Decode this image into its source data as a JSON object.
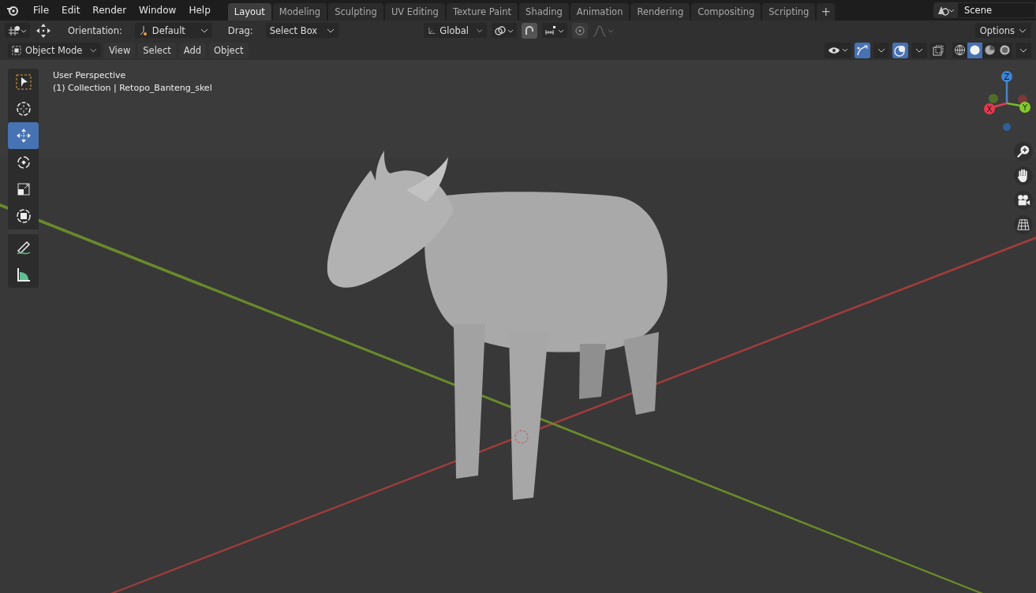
{
  "menu": [
    "File",
    "Edit",
    "Render",
    "Window",
    "Help"
  ],
  "workspaces": [
    {
      "label": "Layout",
      "selected": true
    },
    {
      "label": "Modeling",
      "selected": false
    },
    {
      "label": "Sculpting",
      "selected": false
    },
    {
      "label": "UV Editing",
      "selected": false
    },
    {
      "label": "Texture Paint",
      "selected": false
    },
    {
      "label": "Shading",
      "selected": false
    },
    {
      "label": "Animation",
      "selected": false
    },
    {
      "label": "Rendering",
      "selected": false
    },
    {
      "label": "Compositing",
      "selected": false
    },
    {
      "label": "Scripting",
      "selected": false
    }
  ],
  "add_tab": "+",
  "scene": "Scene",
  "tool_header": {
    "orientation_label": "Orientation:",
    "orientation": "Default",
    "drag_label": "Drag:",
    "drag": "Select Box",
    "transform_orientation": "Global",
    "snap": true,
    "proportional": false,
    "options": "Options"
  },
  "viewport_header": {
    "mode": "Object Mode",
    "menus": [
      "View",
      "Select",
      "Add",
      "Object"
    ],
    "shading": [
      {
        "kind": "wireframe",
        "selected": false
      },
      {
        "kind": "solid",
        "selected": true
      },
      {
        "kind": "material",
        "selected": false
      },
      {
        "kind": "rendered",
        "selected": false
      }
    ]
  },
  "tools": [
    {
      "kind": "select",
      "selected": false
    },
    {
      "kind": "cursor",
      "selected": false
    },
    {
      "kind": "move",
      "selected": true
    },
    {
      "kind": "rotate",
      "selected": false
    },
    {
      "kind": "scale",
      "selected": false
    },
    {
      "kind": "transform",
      "selected": false
    },
    {
      "kind": "annotate",
      "selected": false
    },
    {
      "kind": "measure",
      "selected": false
    }
  ],
  "overlay": {
    "view": "User Perspective",
    "object": "(1) Collection | Retopo_Banteng_skel"
  },
  "gizmo": {
    "axes": [
      {
        "label": "Z"
      },
      {
        "label": "X"
      },
      {
        "label": "Y"
      }
    ]
  }
}
